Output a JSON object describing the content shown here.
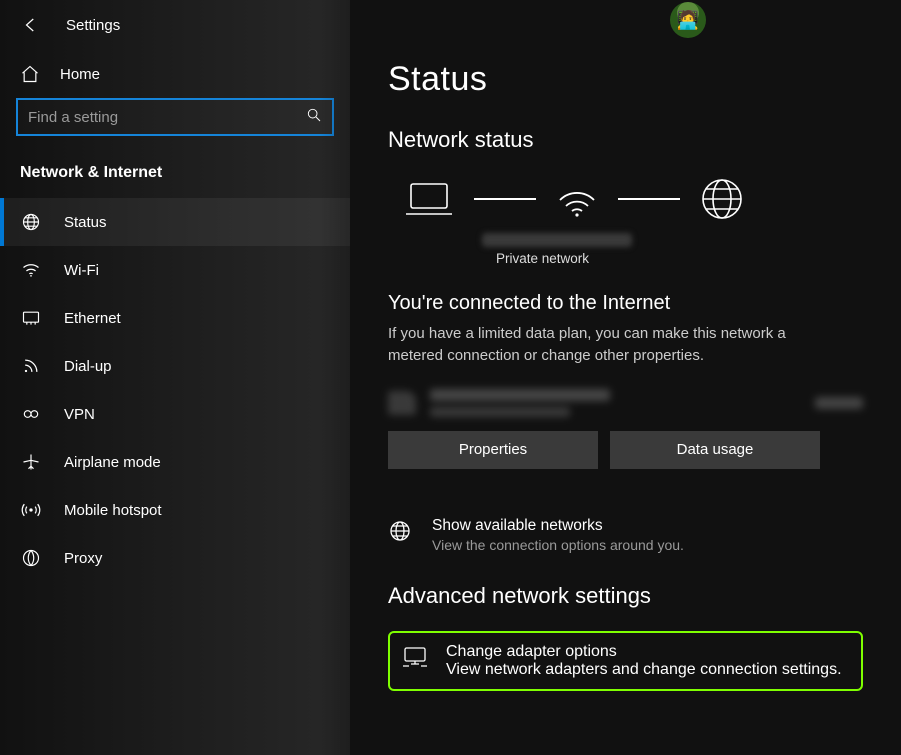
{
  "header": {
    "title": "Settings"
  },
  "home": {
    "label": "Home"
  },
  "search": {
    "placeholder": "Find a setting"
  },
  "section": {
    "title": "Network & Internet"
  },
  "nav": [
    {
      "label": "Status",
      "icon": "globe-icon",
      "active": true
    },
    {
      "label": "Wi-Fi",
      "icon": "wifi-icon",
      "active": false
    },
    {
      "label": "Ethernet",
      "icon": "ethernet-icon",
      "active": false
    },
    {
      "label": "Dial-up",
      "icon": "dialup-icon",
      "active": false
    },
    {
      "label": "VPN",
      "icon": "vpn-icon",
      "active": false
    },
    {
      "label": "Airplane mode",
      "icon": "airplane-icon",
      "active": false
    },
    {
      "label": "Mobile hotspot",
      "icon": "hotspot-icon",
      "active": false
    },
    {
      "label": "Proxy",
      "icon": "proxy-icon",
      "active": false
    }
  ],
  "main": {
    "title": "Status",
    "network_status_heading": "Network status",
    "network_type_label": "Private network",
    "connected_title": "You're connected to the Internet",
    "connected_desc": "If you have a limited data plan, you can make this network a metered connection or change other properties.",
    "buttons": {
      "properties": "Properties",
      "data_usage": "Data usage"
    },
    "show_networks": {
      "title": "Show available networks",
      "desc": "View the connection options around you."
    },
    "advanced_heading": "Advanced network settings",
    "adapter": {
      "title": "Change adapter options",
      "desc": "View network adapters and change connection settings."
    }
  }
}
